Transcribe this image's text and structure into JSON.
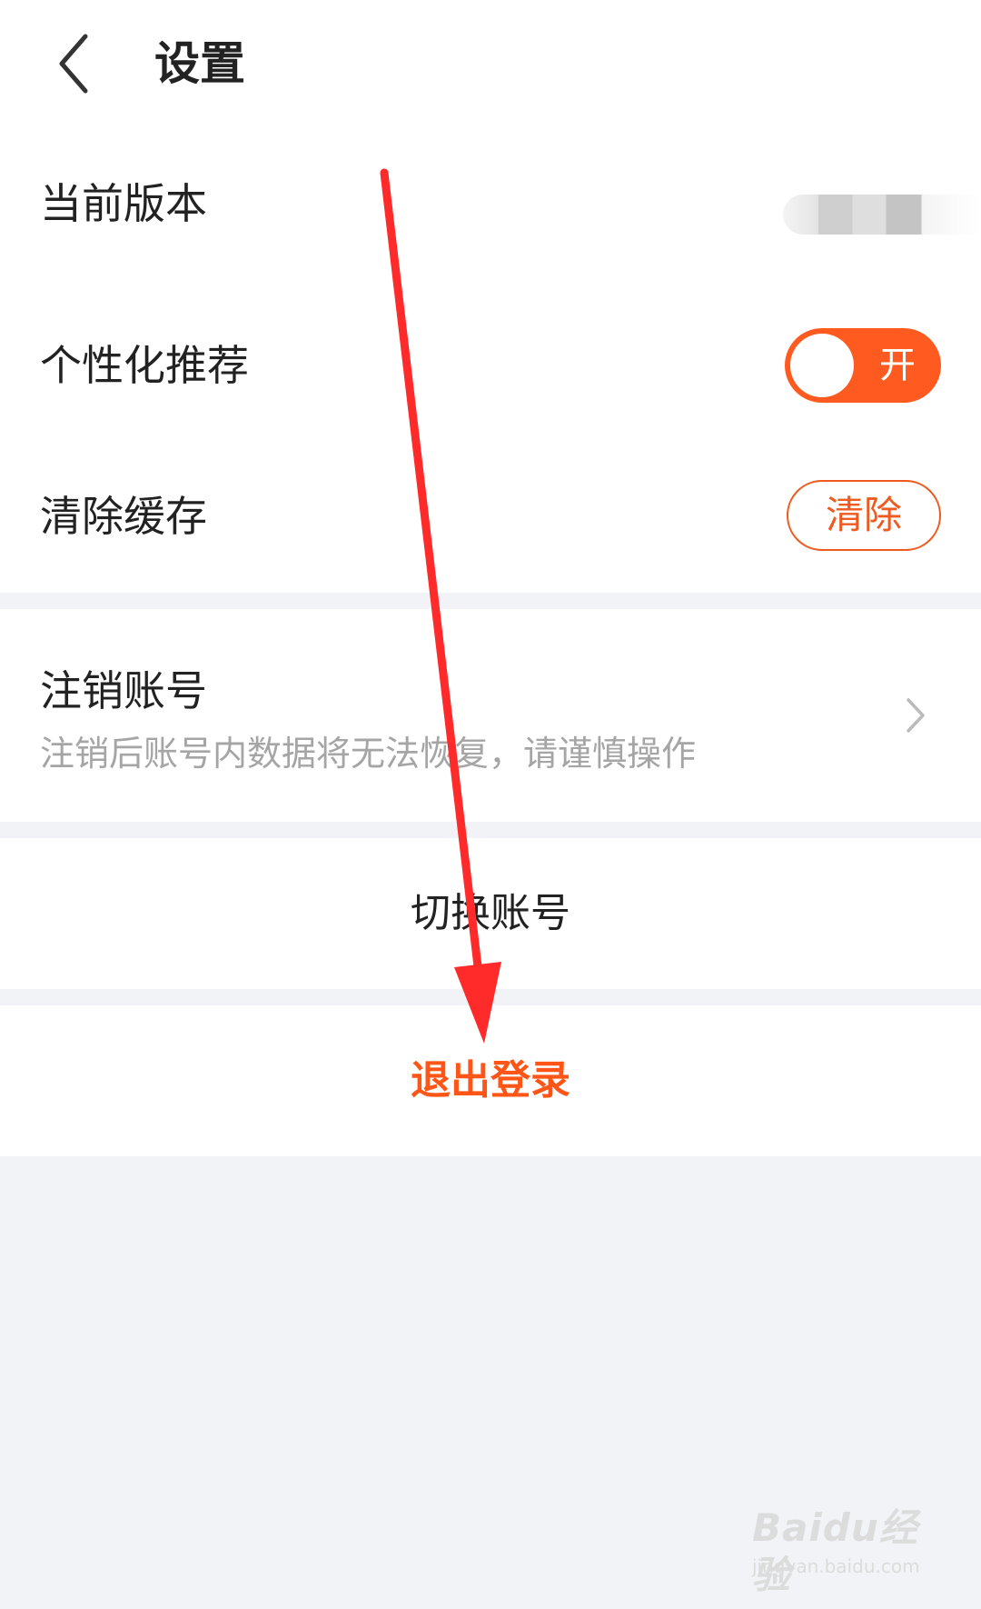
{
  "header": {
    "back_icon": "chevron-left-icon",
    "title": "设置"
  },
  "settings": {
    "current_version": {
      "label": "当前版本",
      "value_note": "blurred"
    },
    "personalized_recommendation": {
      "label": "个性化推荐",
      "toggle_text": "开",
      "enabled": true
    },
    "clear_cache": {
      "label": "清除缓存",
      "button_label": "清除"
    }
  },
  "account": {
    "deactivate_title": "注销账号",
    "deactivate_desc": "注销后账号内数据将无法恢复，请谨慎操作",
    "chevron_icon": "chevron-right-icon"
  },
  "actions": {
    "switch_account": "切换账号",
    "logout": "退出登录"
  },
  "watermark": {
    "logo": "Baidu经验",
    "url": "jingyan.baidu.com"
  },
  "colors": {
    "accent": "#ff5a1f",
    "logout": "#ff5516",
    "background": "#f2f3f7",
    "annotation_arrow": "#ff2a2a"
  }
}
